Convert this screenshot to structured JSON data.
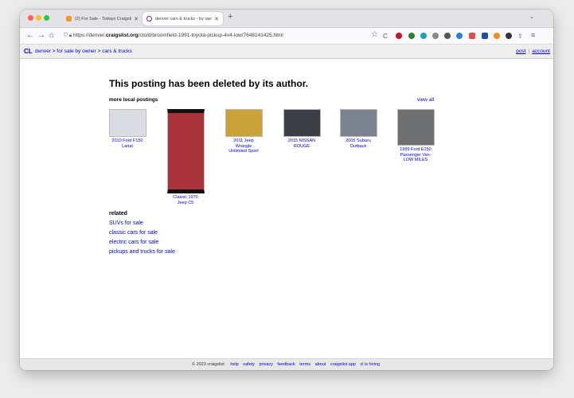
{
  "browser": {
    "tabs": [
      {
        "title": "(2) For Sale - Todays Craigslist",
        "active": false
      },
      {
        "title": "denver cars & trucks - by owner",
        "active": true
      }
    ],
    "url_prefix": "https://denver.",
    "url_domain": "craigslist.org",
    "url_path": "/cto/d/broomfield-1991-toyota-pickup-4x4-low/7648141425.html",
    "new_tab": "+",
    "back": "←",
    "forward": "→",
    "home": "⌂",
    "reload": "C",
    "star": "☆"
  },
  "header": {
    "logo": "CL",
    "crumb_denver": "denver",
    "crumb_owner": "for sale by owner",
    "crumb_cars": "cars & trucks",
    "sep": ">",
    "post": "post",
    "account": "account"
  },
  "main": {
    "deleted_message": "This posting has been deleted by its author.",
    "more_local": "more local postings",
    "view_all": "view all",
    "gallery": [
      {
        "caption_1": "2010 Ford F150",
        "caption_2": "Lariat",
        "caption_3": "",
        "color": "#d9dde2"
      },
      {
        "caption_1": "Classic 1970",
        "caption_2": "Jeep C5",
        "caption_3": "",
        "color": "#a8333d"
      },
      {
        "caption_1": "2011 Jeep",
        "caption_2": "Wrangle",
        "caption_3": "Unlimited Sport",
        "color": "#c9a23a"
      },
      {
        "caption_1": "2015 NISSAN",
        "caption_2": "ROUGE",
        "caption_3": "",
        "color": "#3c3f46"
      },
      {
        "caption_1": "2005 Subaru",
        "caption_2": "Outback",
        "caption_3": "",
        "color": "#7b8290"
      },
      {
        "caption_1": "1999 Ford E150",
        "caption_2": "Passenger Van-",
        "caption_3": "LOW MILES",
        "color": "#6e6f70"
      }
    ],
    "related_title": "related",
    "related": [
      "SUVs for sale",
      "classic cars for sale",
      "electric cars for sale",
      "pickups and trucks for sale"
    ]
  },
  "footer": {
    "copyright": "© 2023 craigslist",
    "links": [
      "help",
      "safety",
      "privacy",
      "feedback",
      "terms",
      "about",
      "craigslist app",
      "cl is hiring"
    ]
  }
}
